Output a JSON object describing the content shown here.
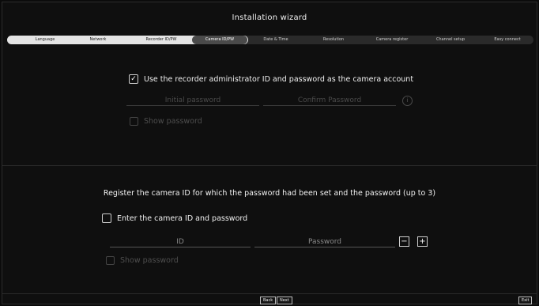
{
  "window": {
    "title": "Installation wizard"
  },
  "steps": [
    {
      "label": "Language",
      "state": "done"
    },
    {
      "label": "Network",
      "state": "done"
    },
    {
      "label": "Recorder ID/PW",
      "state": "done"
    },
    {
      "label": "Camera ID/PW",
      "state": "current"
    },
    {
      "label": "Date & Time",
      "state": "pending"
    },
    {
      "label": "Resolution",
      "state": "pending"
    },
    {
      "label": "Camera register",
      "state": "pending"
    },
    {
      "label": "Channel setup",
      "state": "pending"
    },
    {
      "label": "Easy connect",
      "state": "pending"
    }
  ],
  "section1": {
    "use_admin_checked": true,
    "use_admin_label": "Use the recorder administrator ID and password as the camera account",
    "initial_password_placeholder": "Initial password",
    "confirm_password_placeholder": "Confirm Password",
    "info_icon": "info-icon",
    "show_password_label": "Show password"
  },
  "section2": {
    "headline": "Register the camera ID for which the password had been set and the password (up to 3)",
    "enter_label": "Enter the camera ID and password",
    "enter_checked": false,
    "id_placeholder": "ID",
    "password_placeholder": "Password",
    "minus_label": "−",
    "plus_label": "+",
    "show_password_label": "Show password"
  },
  "footer": {
    "back_label": "Back",
    "next_label": "Next",
    "exit_label": "Exit"
  },
  "colors": {
    "background": "#0f0f0f",
    "progress_done": "#e4e4e4",
    "progress_track": "#2a2a2a",
    "text": "#f0f0f0"
  }
}
